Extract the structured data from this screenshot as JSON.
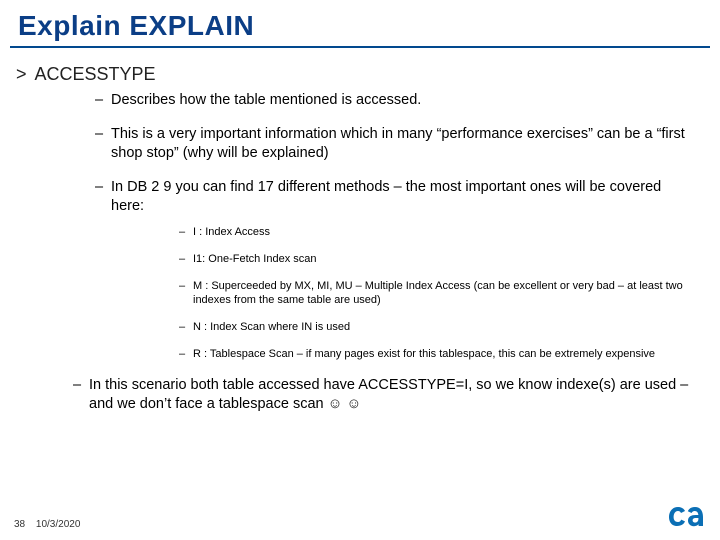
{
  "title": "Explain EXPLAIN",
  "subhead": "ACCESSTYPE",
  "bullets": {
    "b1": "Describes how the table mentioned is accessed.",
    "b2": "This is a very important information which in many “performance exercises” can be a “first shop stop” (why will be explained)",
    "b3": "In DB 2 9 you can find 17 different methods – the most important ones will be covered here:"
  },
  "methods": {
    "m1": "I  : Index Access",
    "m2": "I1: One-Fetch Index scan",
    "m3": "M : Superceeded by MX, MI, MU – Multiple Index Access (can be excellent or very bad – at least two indexes from the same table are used)",
    "m4": "N : Index Scan where IN is used",
    "m5": "R : Tablespace Scan – if many pages exist for this tablespace, this can be extremely expensive"
  },
  "closing": "In this scenario both table accessed have ACCESSTYPE=I, so we know indexe(s) are used – and we don’t face a tablespace scan ☺ ☺",
  "footer": {
    "page": "38",
    "date": "10/3/2020"
  }
}
